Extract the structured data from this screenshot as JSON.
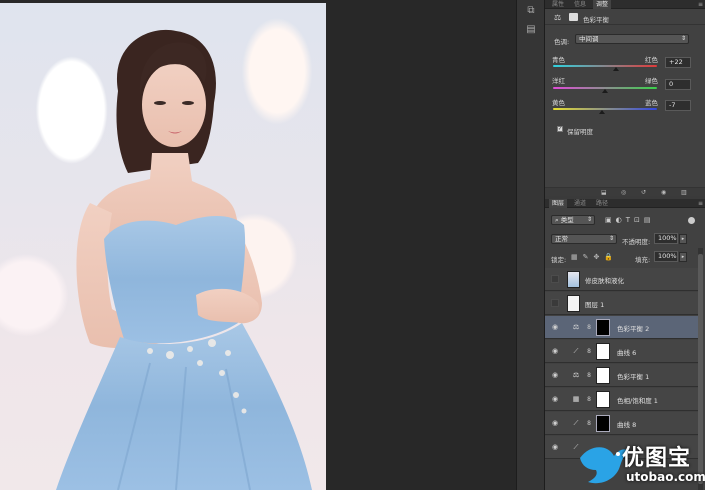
{
  "dock": {
    "icons": [
      "layers-dock-icon",
      "adjustments-dock-icon"
    ]
  },
  "properties_panel": {
    "tabs": [
      "属性",
      "信息",
      "调整"
    ],
    "title": "色彩平衡",
    "tone_label": "色调:",
    "tone_value": "中间调",
    "sliders": [
      {
        "left": "青色",
        "right": "红色",
        "value": "+22",
        "level": 0.61
      },
      {
        "left": "洋红",
        "right": "绿色",
        "value": "0",
        "level": 0.5
      },
      {
        "left": "黄色",
        "right": "蓝色",
        "value": "-7",
        "level": 0.47
      }
    ],
    "preserve_luminosity_label": "保留明度",
    "preserve_luminosity_checked": true
  },
  "layers_panel": {
    "tabs": [
      "图层",
      "通道",
      "路径"
    ],
    "filter_value": "类型",
    "blend_mode": "正常",
    "opacity_label": "不透明度:",
    "opacity_value": "100%",
    "lock_label": "锁定:",
    "fill_label": "填充:",
    "fill_value": "100%",
    "layers": [
      {
        "name": "修皮肤和液化",
        "type": "pixel",
        "visible": false,
        "selected": false
      },
      {
        "name": "图层 1",
        "type": "pixel",
        "visible": false,
        "selected": false
      },
      {
        "name": "色彩平衡 2",
        "type": "color-balance",
        "visible": true,
        "selected": true,
        "mask": "dark"
      },
      {
        "name": "曲线 6",
        "type": "curves",
        "visible": true,
        "selected": false,
        "mask": "white"
      },
      {
        "name": "色彩平衡 1",
        "type": "color-balance",
        "visible": true,
        "selected": false,
        "mask": "white"
      },
      {
        "name": "色相/饱和度 1",
        "type": "hue-saturation",
        "visible": true,
        "selected": false,
        "mask": "white"
      },
      {
        "name": "曲线 8",
        "type": "curves",
        "visible": true,
        "selected": false,
        "mask": "dark"
      }
    ]
  },
  "watermark": {
    "brand": "优图宝",
    "url": "utobao.com"
  },
  "colors": {
    "selected_row": "#5b6577",
    "panel": "#414141",
    "workspace": "#282828"
  }
}
